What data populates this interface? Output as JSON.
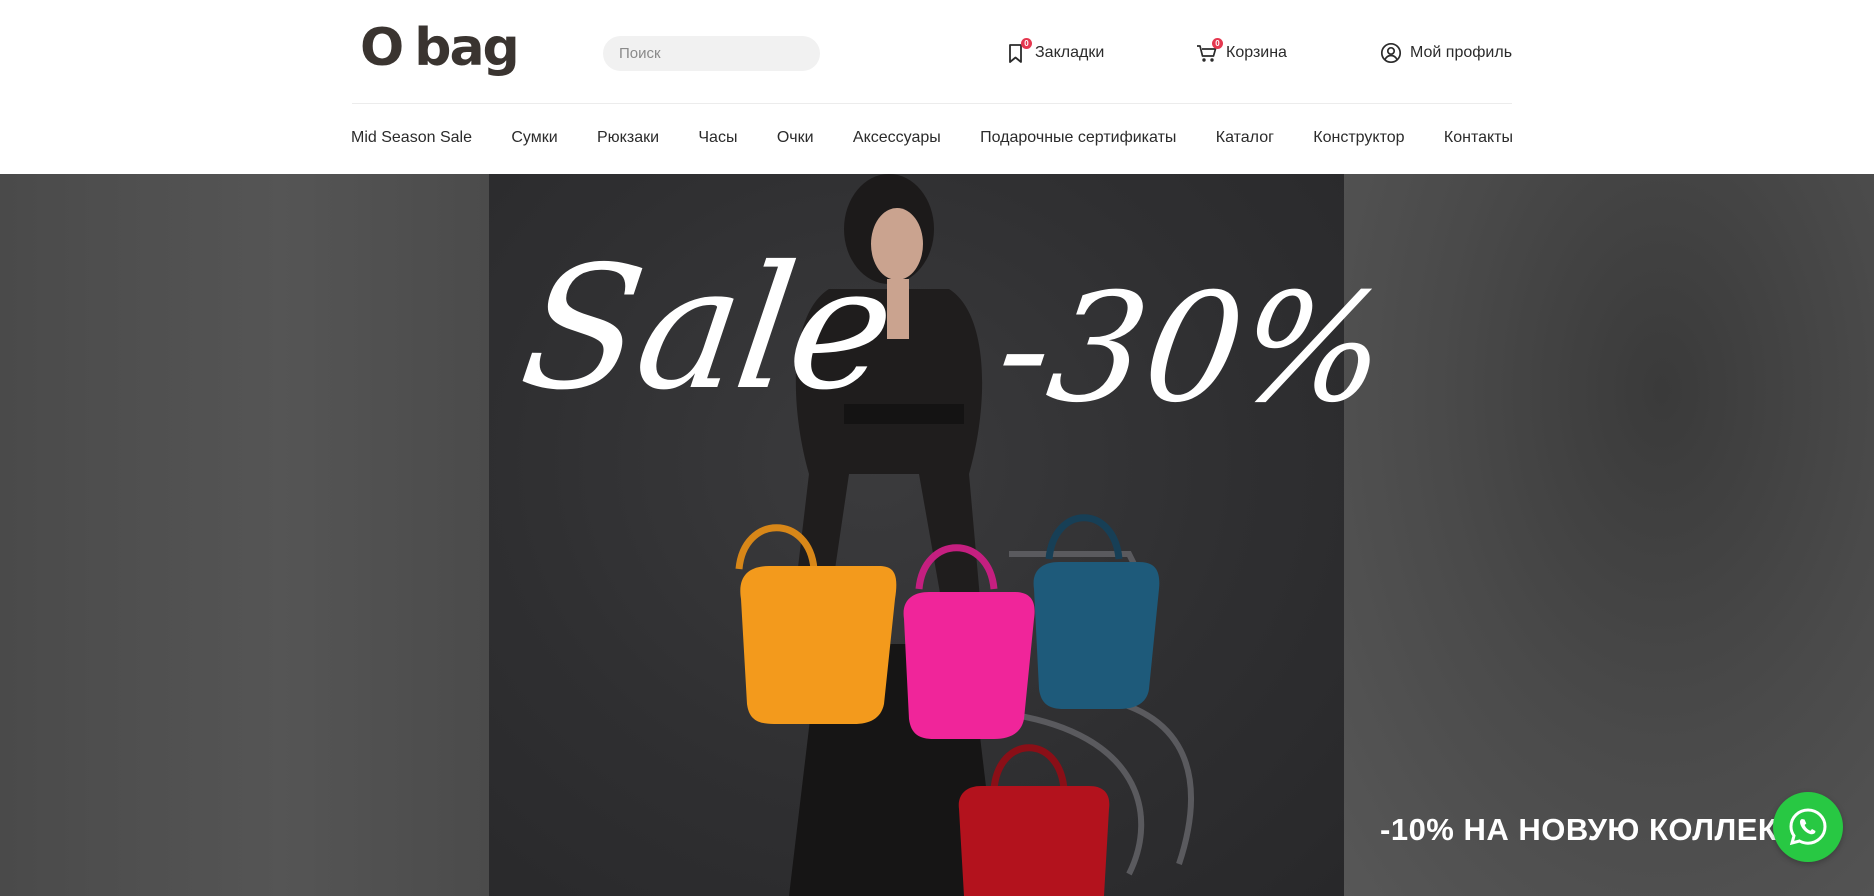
{
  "logo": {
    "text_o": "O",
    "text_bag": "bag"
  },
  "search": {
    "placeholder": "Поиск",
    "value": ""
  },
  "header_links": {
    "bookmarks": {
      "label": "Закладки",
      "count": "0"
    },
    "cart": {
      "label": "Корзина",
      "count": "0"
    },
    "profile": {
      "label": "Мой профиль"
    }
  },
  "nav": [
    {
      "label": "Mid Season Sale"
    },
    {
      "label": "Сумки"
    },
    {
      "label": "Рюкзаки"
    },
    {
      "label": "Часы"
    },
    {
      "label": "Очки"
    },
    {
      "label": "Аксессуары"
    },
    {
      "label": "Подарочные сертификаты"
    },
    {
      "label": "Каталог"
    },
    {
      "label": "Конструктор"
    },
    {
      "label": "Контакты"
    }
  ],
  "hero": {
    "sale_word": "Sale",
    "discount": "-30%",
    "promo_text": "-10% НА НОВУЮ КОЛЛЕКЦ",
    "bag_colors": {
      "orange": "#f39a1c",
      "pink": "#f0259a",
      "blue": "#1e5a7a",
      "red": "#b3121d"
    }
  },
  "colors": {
    "badge": "#e5374f",
    "whatsapp": "#28c843",
    "text": "#2b2b2b"
  },
  "icons": {
    "search": "search-icon",
    "bookmark": "bookmark-icon",
    "cart": "cart-icon",
    "profile": "user-circle-icon",
    "whatsapp": "whatsapp-icon"
  }
}
